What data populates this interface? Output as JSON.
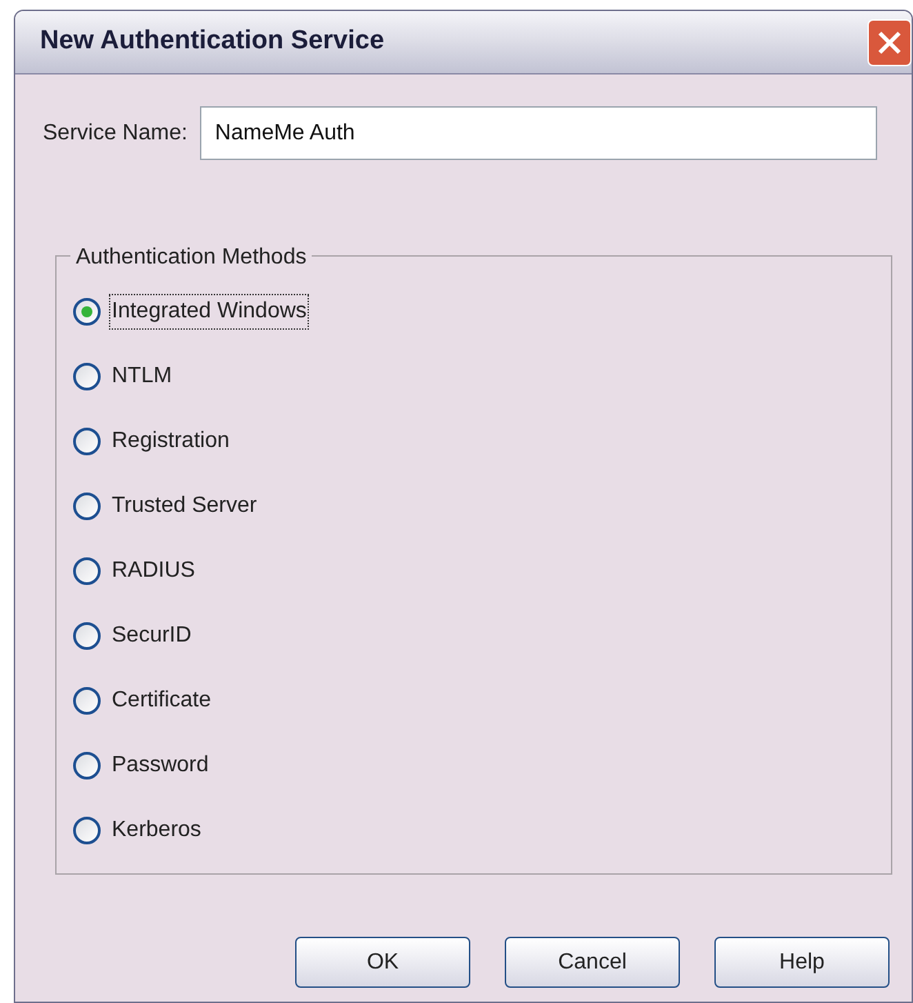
{
  "window": {
    "title": "New Authentication Service"
  },
  "service_name": {
    "label": "Service Name:",
    "value": "NameMe Auth"
  },
  "methods": {
    "title": "Authentication Methods",
    "options": [
      {
        "label": "Integrated Windows",
        "selected": true
      },
      {
        "label": "NTLM",
        "selected": false
      },
      {
        "label": "Registration",
        "selected": false
      },
      {
        "label": "Trusted Server",
        "selected": false
      },
      {
        "label": "RADIUS",
        "selected": false
      },
      {
        "label": "SecurID",
        "selected": false
      },
      {
        "label": "Certificate",
        "selected": false
      },
      {
        "label": "Password",
        "selected": false
      },
      {
        "label": "Kerberos",
        "selected": false
      }
    ]
  },
  "buttons": [
    "OK",
    "Cancel",
    "Help"
  ]
}
